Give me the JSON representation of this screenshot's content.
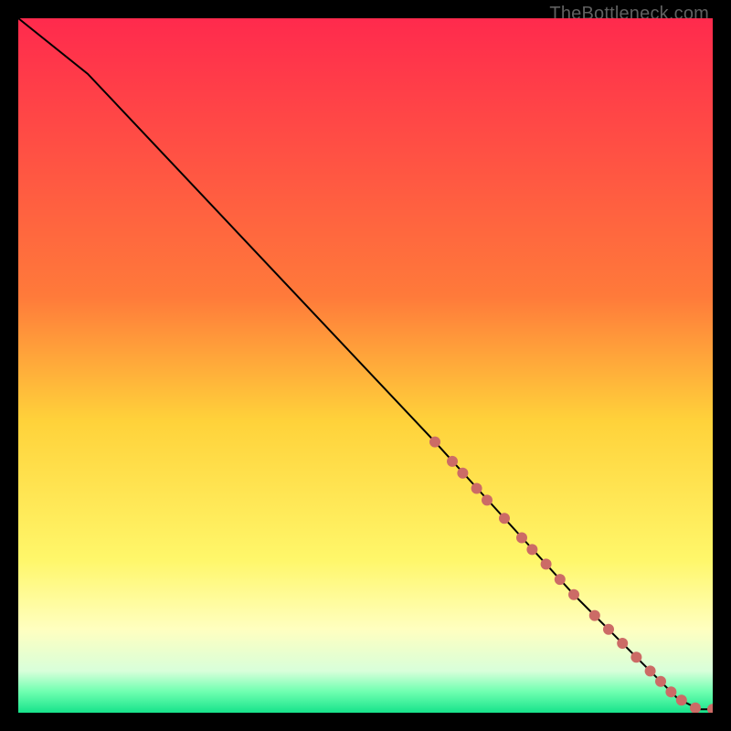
{
  "watermark": "TheBottleneck.com",
  "chart_data": {
    "type": "line",
    "title": "",
    "xlabel": "",
    "ylabel": "",
    "xlim": [
      0,
      100
    ],
    "ylim": [
      0,
      100
    ],
    "grid": false,
    "gradient_stops": [
      {
        "offset": 0,
        "color": "#ff2a4d"
      },
      {
        "offset": 40,
        "color": "#ff7a3a"
      },
      {
        "offset": 58,
        "color": "#ffd23a"
      },
      {
        "offset": 78,
        "color": "#fff76a"
      },
      {
        "offset": 88,
        "color": "#ffffc0"
      },
      {
        "offset": 94,
        "color": "#d8ffda"
      },
      {
        "offset": 97,
        "color": "#6effb0"
      },
      {
        "offset": 100,
        "color": "#17e38b"
      }
    ],
    "series": [
      {
        "name": "bottleneck-curve",
        "color": "#000000",
        "x": [
          0,
          10,
          60,
          80,
          90,
          95,
          98,
          100
        ],
        "y": [
          100,
          92,
          39,
          17,
          7,
          2,
          0.5,
          0.5
        ]
      }
    ],
    "markers": {
      "name": "highlighted-points",
      "color": "#cc6b66",
      "radius": 6,
      "points": [
        {
          "x": 60.0,
          "y": 39.0
        },
        {
          "x": 62.5,
          "y": 36.2
        },
        {
          "x": 64.0,
          "y": 34.5
        },
        {
          "x": 66.0,
          "y": 32.3
        },
        {
          "x": 67.5,
          "y": 30.6
        },
        {
          "x": 70.0,
          "y": 28.0
        },
        {
          "x": 72.5,
          "y": 25.2
        },
        {
          "x": 74.0,
          "y": 23.5
        },
        {
          "x": 76.0,
          "y": 21.4
        },
        {
          "x": 78.0,
          "y": 19.2
        },
        {
          "x": 80.0,
          "y": 17.0
        },
        {
          "x": 83.0,
          "y": 14.0
        },
        {
          "x": 85.0,
          "y": 12.0
        },
        {
          "x": 87.0,
          "y": 10.0
        },
        {
          "x": 89.0,
          "y": 8.0
        },
        {
          "x": 91.0,
          "y": 6.0
        },
        {
          "x": 92.5,
          "y": 4.5
        },
        {
          "x": 94.0,
          "y": 3.0
        },
        {
          "x": 95.5,
          "y": 1.8
        },
        {
          "x": 97.5,
          "y": 0.7
        },
        {
          "x": 100.0,
          "y": 0.5
        }
      ]
    }
  }
}
